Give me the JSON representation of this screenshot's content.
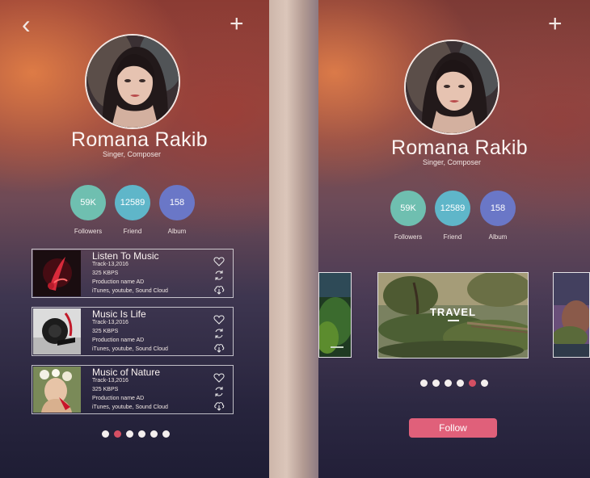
{
  "colors": {
    "followers": "#6fbfb0",
    "friend": "#5fb6c9",
    "album": "#6a77c7",
    "active_dot": "#d54f63",
    "follow_button": "#e0607a"
  },
  "left_screen": {
    "nav": {
      "back_icon": "back-chevron-icon",
      "add_icon": "plus-icon"
    },
    "profile": {
      "name": "Romana Rakib",
      "role": "Singer, Composer"
    },
    "stats": [
      {
        "value": "59K",
        "label": "Followers"
      },
      {
        "value": "12589",
        "label": "Friend"
      },
      {
        "value": "158",
        "label": "Album"
      }
    ],
    "tracks": [
      {
        "title": "Listen To Music",
        "track": "Track-13,2016",
        "bitrate": "325 KBPS",
        "production": "Production name AD",
        "platforms": "iTunes, youtube, Sound Cloud"
      },
      {
        "title": "Music Is Life",
        "track": "Track-13,2016",
        "bitrate": "325 KBPS",
        "production": "Production name AD",
        "platforms": "iTunes, youtube, Sound Cloud"
      },
      {
        "title": "Music of Nature",
        "track": "Track-13,2016",
        "bitrate": "325 KBPS",
        "production": "Production name AD",
        "platforms": "iTunes, youtube, Sound Cloud"
      }
    ],
    "pagination": {
      "count": 6,
      "active_index": 1
    }
  },
  "right_screen": {
    "nav": {
      "add_icon": "plus-icon"
    },
    "profile": {
      "name": "Romana Rakib",
      "role": "Singer, Composer"
    },
    "stats": [
      {
        "value": "59K",
        "label": "Followers"
      },
      {
        "value": "12589",
        "label": "Friend"
      },
      {
        "value": "158",
        "label": "Album"
      }
    ],
    "gallery": {
      "featured_label": "TRAVEL"
    },
    "pagination": {
      "count": 6,
      "active_index": 4
    },
    "follow_label": "Follow"
  }
}
